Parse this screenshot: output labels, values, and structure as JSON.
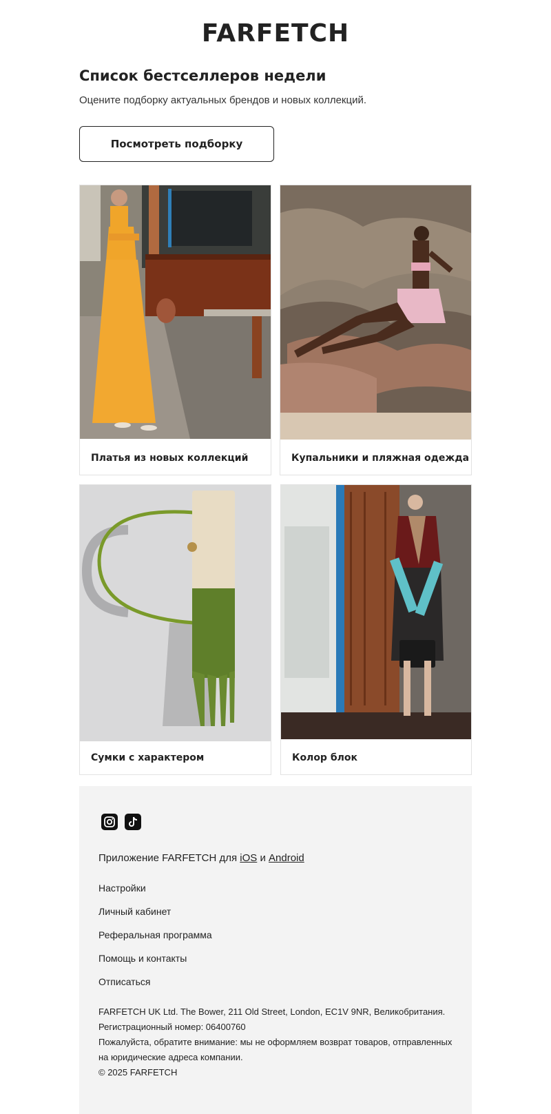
{
  "brand": {
    "logo_text": "FARFETCH"
  },
  "hero": {
    "title": "Список бестселлеров недели",
    "subtitle": "Оцените подборку актуальных брендов и новых коллекций.",
    "button_label": "Посмотреть подборку"
  },
  "cards": [
    {
      "caption": "Платья из новых коллекций"
    },
    {
      "caption": "Купальники и пляжная одежда"
    },
    {
      "caption": "Сумки с характером"
    },
    {
      "caption": "Колор блок"
    }
  ],
  "footer": {
    "social_icons": [
      "instagram-icon",
      "tiktok-icon"
    ],
    "app_prefix": "Приложение FARFETCH для",
    "app_ios": "iOS",
    "app_and": "и",
    "app_android": "Android",
    "links": [
      "Настройки",
      "Личный кабинет",
      "Реферальная программа",
      "Помощь и контакты",
      "Отписаться"
    ],
    "legal": [
      "FARFETCH UK Ltd. The Bower, 211 Old Street, London, EC1V 9NR, Великобритания.",
      "Регистрационный номер: 06400760",
      "Пожалуйста, обратите внимание: мы не оформляем возврат товаров, отправленных",
      "на юридические адреса компании.",
      "© 2025 FARFETCH"
    ]
  },
  "colors": {
    "text": "#222222",
    "footer_bg": "#f3f3f3",
    "border": "#e2e2e2"
  }
}
